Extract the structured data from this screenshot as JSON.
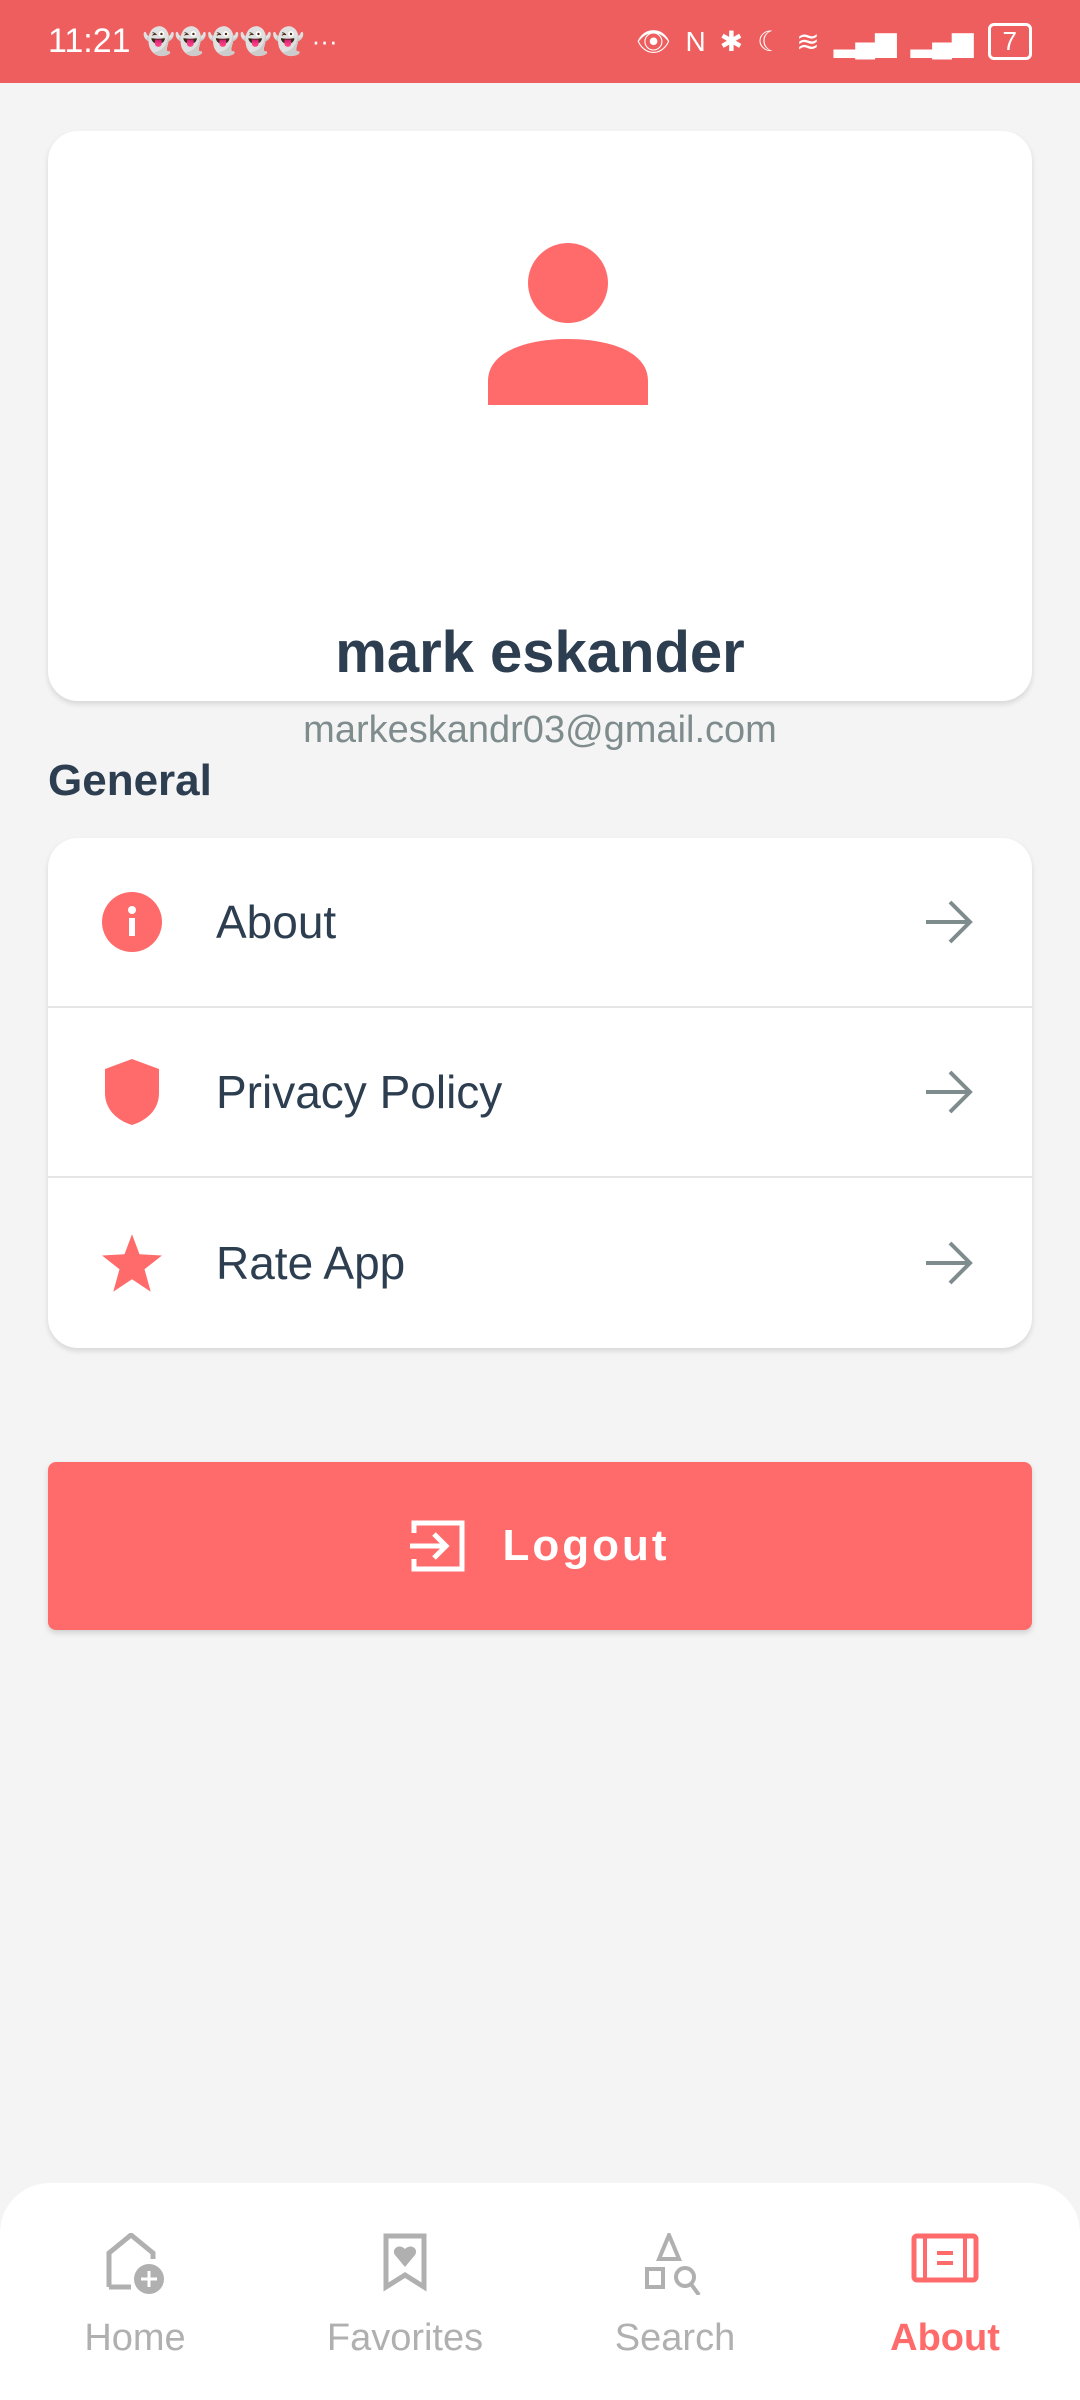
{
  "status_bar": {
    "time": "11:21",
    "notifications": "👻👻👻👻👻 ···",
    "battery": "7"
  },
  "profile": {
    "name": "mark eskander",
    "email": "markeskandr03@gmail.com"
  },
  "general": {
    "title": "General",
    "items": [
      {
        "label": "About",
        "icon": "info-icon"
      },
      {
        "label": "Privacy Policy",
        "icon": "shield-icon"
      },
      {
        "label": "Rate App",
        "icon": "star-icon"
      }
    ]
  },
  "logout": {
    "label": "Logout"
  },
  "nav": {
    "tabs": [
      {
        "label": "Home"
      },
      {
        "label": "Favorites"
      },
      {
        "label": "Search"
      },
      {
        "label": "About",
        "active": true
      }
    ]
  },
  "colors": {
    "accent": "#ff6b6b",
    "status": "#ef5e5e",
    "text": "#2c3e50"
  }
}
